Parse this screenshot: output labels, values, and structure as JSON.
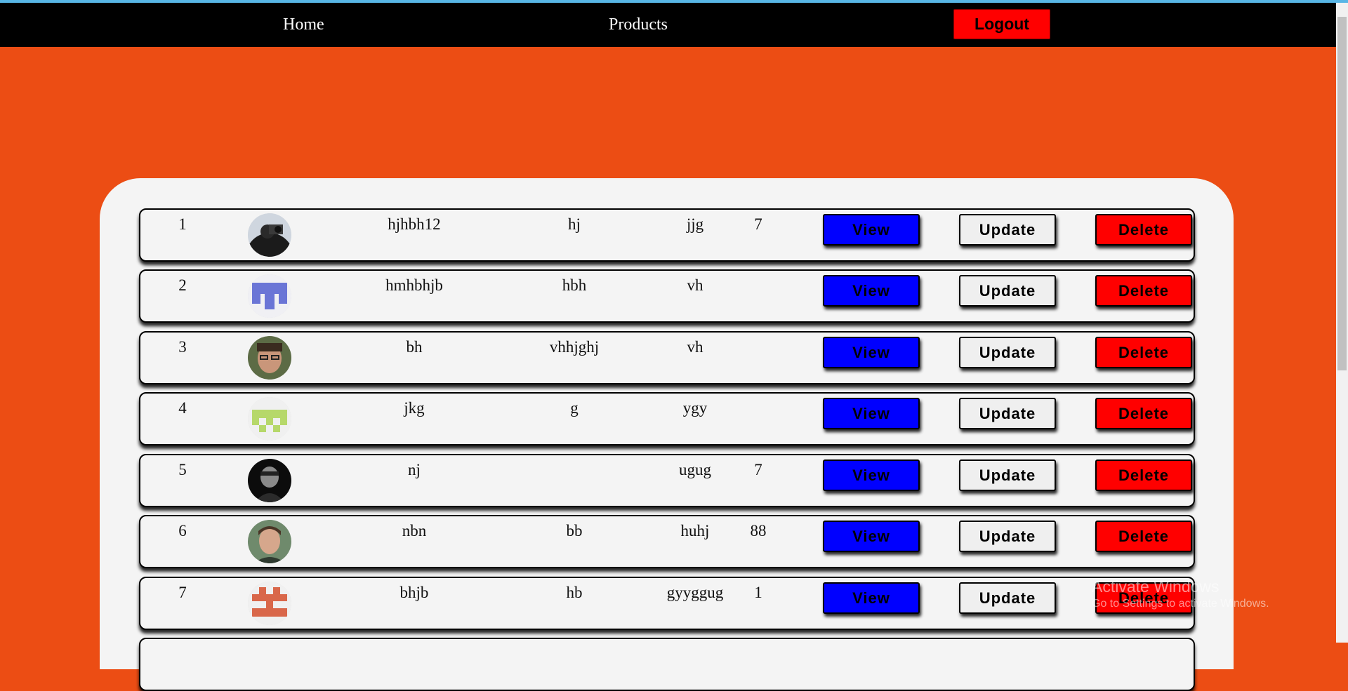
{
  "nav": {
    "home": "Home",
    "products": "Products",
    "logout": "Logout"
  },
  "buttons": {
    "view": "View",
    "update": "Update",
    "delete": "Delete"
  },
  "rows": [
    {
      "id": "1",
      "name": "hjhbh12",
      "a": "hj",
      "b": "jjg",
      "n": "7",
      "avatar": "photo-person-camera-icon"
    },
    {
      "id": "2",
      "name": "hmhbhjb",
      "a": "hbh",
      "b": "vh",
      "n": "",
      "avatar": "blue-identicon-icon"
    },
    {
      "id": "3",
      "name": "bh",
      "a": "vhhjghj",
      "b": "vh",
      "n": "",
      "avatar": "photo-man-glasses-icon"
    },
    {
      "id": "4",
      "name": "jkg",
      "a": "g",
      "b": "ygy",
      "n": "",
      "avatar": "green-identicon-icon"
    },
    {
      "id": "5",
      "name": "nj",
      "a": "",
      "b": "ugug",
      "n": "7",
      "avatar": "photo-dark-person-icon"
    },
    {
      "id": "6",
      "name": "nbn",
      "a": "bb",
      "b": "huhj",
      "n": "88",
      "avatar": "photo-young-man-icon"
    },
    {
      "id": "7",
      "name": "bhjb",
      "a": "hb",
      "b": "gyyggug",
      "n": "1",
      "avatar": "orange-identicon-icon"
    }
  ],
  "watermark": {
    "title": "Activate Windows",
    "subtitle": "Go to Settings to activate Windows."
  }
}
